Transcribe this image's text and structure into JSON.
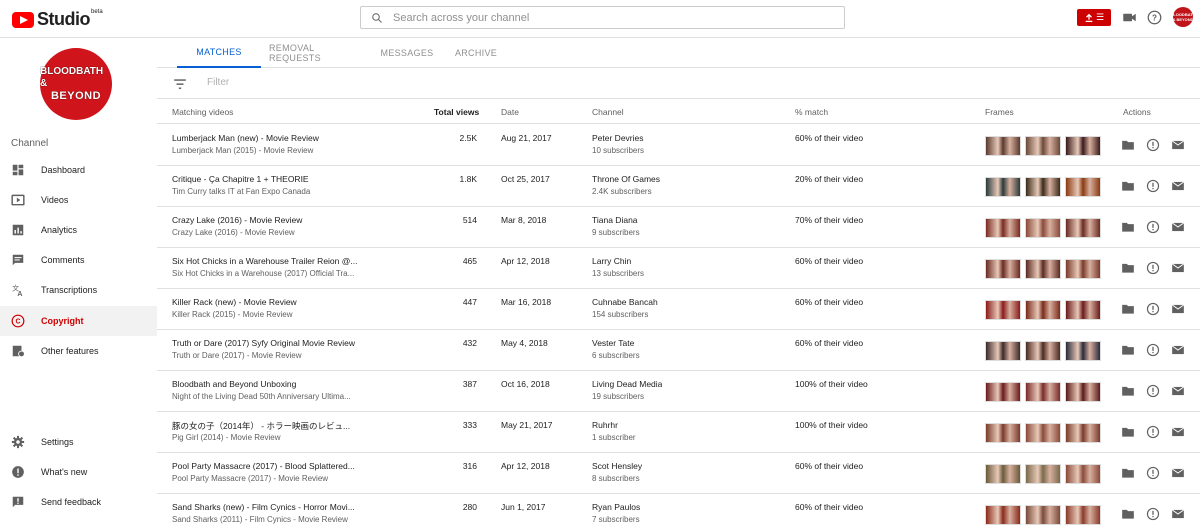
{
  "header": {
    "logo_text": "Studio",
    "logo_badge": "beta",
    "search_placeholder": "Search across your channel",
    "create_label": "☰",
    "avatar_text": "BLOODBATH & BEYOND"
  },
  "sidebar": {
    "channel_logo_line1": "BLOODBATH &",
    "channel_logo_line2": "BEYOND",
    "section_label": "Channel",
    "items": [
      {
        "label": "Dashboard",
        "icon": "dashboard-icon"
      },
      {
        "label": "Videos",
        "icon": "videos-icon"
      },
      {
        "label": "Analytics",
        "icon": "analytics-icon"
      },
      {
        "label": "Comments",
        "icon": "comments-icon"
      },
      {
        "label": "Transcriptions",
        "icon": "translate-icon"
      },
      {
        "label": "Copyright",
        "icon": "copyright-icon",
        "active": true
      },
      {
        "label": "Other features",
        "icon": "other-features-icon"
      }
    ],
    "bottom_items": [
      {
        "label": "Settings",
        "icon": "gear-icon"
      },
      {
        "label": "What's new",
        "icon": "whats-new-icon"
      },
      {
        "label": "Send feedback",
        "icon": "feedback-icon"
      }
    ]
  },
  "tabs": [
    {
      "label": "MATCHES",
      "active": true
    },
    {
      "label": "REMOVAL REQUESTS"
    },
    {
      "label": "MESSAGES"
    },
    {
      "label": "ARCHIVE"
    }
  ],
  "filter": {
    "placeholder": "Filter"
  },
  "table": {
    "headers": {
      "matching_videos": "Matching videos",
      "total_views": "Total views",
      "date": "Date",
      "channel": "Channel",
      "match": "% match",
      "frames": "Frames",
      "actions": "Actions"
    },
    "rows": [
      {
        "title": "Lumberjack Man (new) - Movie Review",
        "subtitle": "Lumberjack Man (2015) - Movie Review",
        "views": "2.5K",
        "date": "Aug 21, 2017",
        "channel": "Peter Devries",
        "subscribers": "10 subscribers",
        "match": "60% of their video",
        "frames": [
          "#5a3a2e",
          "#6b4a3a",
          "#3a1a1a"
        ]
      },
      {
        "title": "Critique - Ça Chapitre 1 + THEORIE",
        "subtitle": "Tim Curry talks IT at Fan Expo Canada",
        "views": "1.8K",
        "date": "Oct 25, 2017",
        "channel": "Throne Of Games",
        "subscribers": "2.4K subscribers",
        "match": "20% of their video",
        "frames": [
          "#2a3a3a",
          "#3a2a1a",
          "#8a3a10"
        ]
      },
      {
        "title": "Crazy Lake (2016) - Movie Review",
        "subtitle": "Crazy Lake (2016) - Movie Review",
        "views": "514",
        "date": "Mar 8, 2018",
        "channel": "Tiana Diana",
        "subscribers": "9 subscribers",
        "match": "70% of their video",
        "frames": [
          "#7a2a22",
          "#8a4a3a",
          "#6a2a22"
        ]
      },
      {
        "title": "Six Hot Chicks in a Warehouse Trailer Reion @...",
        "subtitle": "Six Hot Chicks in a Warehouse (2017) Official Tra...",
        "views": "465",
        "date": "Apr 12, 2018",
        "channel": "Larry Chin",
        "subscribers": "13 subscribers",
        "match": "60% of their video",
        "frames": [
          "#6a2a22",
          "#5a2a22",
          "#7a3a2a"
        ]
      },
      {
        "title": "Killer Rack (new) - Movie Review",
        "subtitle": "Killer Rack (2015) - Movie Review",
        "views": "447",
        "date": "Mar 16, 2018",
        "channel": "Cuhnabe Bancah",
        "subscribers": "154 subscribers",
        "match": "60% of their video",
        "frames": [
          "#8a1a1a",
          "#7a2a1a",
          "#6a1a1a"
        ]
      },
      {
        "title": "Truth or Dare (2017) Syfy Original Movie Review",
        "subtitle": "Truth or Dare (2017) - Movie Review",
        "views": "432",
        "date": "May 4, 2018",
        "channel": "Vester Tate",
        "subscribers": "6 subscribers",
        "match": "60% of their video",
        "frames": [
          "#3a2a2a",
          "#4a2a22",
          "#2a2a3a"
        ]
      },
      {
        "title": "Bloodbath and Beyond Unboxing",
        "subtitle": "Night of the Living Dead 50th Anniversary Ultima...",
        "views": "387",
        "date": "Oct 16, 2018",
        "channel": "Living Dead Media",
        "subscribers": "19 subscribers",
        "match": "100% of their video",
        "frames": [
          "#6a1a1a",
          "#7a2a2a",
          "#5a1a1a"
        ]
      },
      {
        "title": "豚の女の子（2014年） - ホラー映画のレビュ...",
        "subtitle": "Pig Girl (2014) - Movie Review",
        "views": "333",
        "date": "May 21, 2017",
        "channel": "Ruhrhr",
        "subscribers": "1 subscriber",
        "match": "100% of their video",
        "frames": [
          "#7a3a2a",
          "#8a4a3a",
          "#7a3a2a"
        ]
      },
      {
        "title": "Pool Party Massacre (2017) - Blood Splattered...",
        "subtitle": "Pool Party Massacre (2017) - Movie Review",
        "views": "316",
        "date": "Apr 12, 2018",
        "channel": "Scot Hensley",
        "subscribers": "8 subscribers",
        "match": "60% of their video",
        "frames": [
          "#6a5a3a",
          "#7a6a4a",
          "#8a4a3a"
        ]
      },
      {
        "title": "Sand Sharks (new) - Film Cynics - Horror Movi...",
        "subtitle": "Sand Sharks (2011) - Film Cynics - Movie Review",
        "views": "280",
        "date": "Jun 1, 2017",
        "channel": "Ryan Paulos",
        "subscribers": "7 subscribers",
        "match": "60% of their video",
        "frames": [
          "#8a2a1a",
          "#7a4a3a",
          "#8a3a2a"
        ]
      }
    ]
  }
}
